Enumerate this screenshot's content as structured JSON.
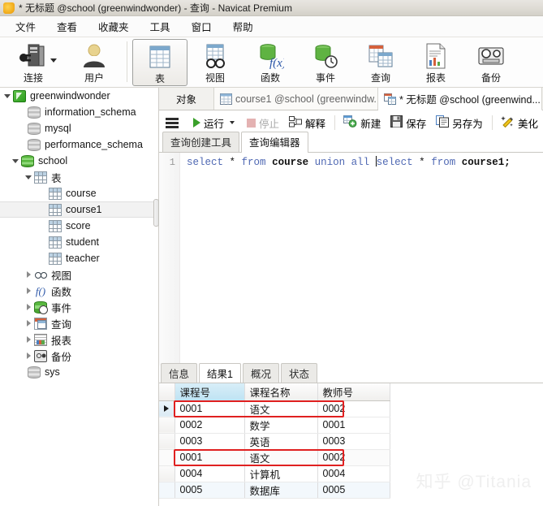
{
  "window": {
    "title": "* 无标题 @school (greenwindwonder) - 查询 - Navicat Premium",
    "app_icon": "navicat-icon"
  },
  "menubar": {
    "items": [
      {
        "label": "文件"
      },
      {
        "label": "查看"
      },
      {
        "label": "收藏夹"
      },
      {
        "label": "工具"
      },
      {
        "label": "窗口"
      },
      {
        "label": "帮助"
      }
    ]
  },
  "main_toolbar": {
    "groups": [
      {
        "items": [
          {
            "label": "连接",
            "icon": "connection-icon",
            "has_dropdown": true,
            "active": false
          },
          {
            "label": "用户",
            "icon": "user-icon",
            "has_dropdown": false,
            "active": false
          }
        ]
      },
      {
        "items": [
          {
            "label": "表",
            "icon": "table-icon",
            "has_dropdown": false,
            "active": true
          },
          {
            "label": "视图",
            "icon": "view-icon",
            "has_dropdown": false,
            "active": false
          },
          {
            "label": "函数",
            "icon": "function-icon",
            "has_dropdown": false,
            "active": false
          },
          {
            "label": "事件",
            "icon": "event-icon",
            "has_dropdown": false,
            "active": false
          },
          {
            "label": "查询",
            "icon": "query-icon",
            "has_dropdown": false,
            "active": false
          },
          {
            "label": "报表",
            "icon": "report-icon",
            "has_dropdown": false,
            "active": false
          },
          {
            "label": "备份",
            "icon": "backup-icon",
            "has_dropdown": false,
            "active": false
          }
        ]
      }
    ]
  },
  "sidebar": {
    "nodes": [
      {
        "label": "greenwindwonder",
        "icon": "connection-node-icon",
        "indent": 0,
        "arrow": "open",
        "selected": false
      },
      {
        "label": "information_schema",
        "icon": "database-icon",
        "indent": 1,
        "arrow": "none",
        "selected": false
      },
      {
        "label": "mysql",
        "icon": "database-icon",
        "indent": 1,
        "arrow": "none",
        "selected": false
      },
      {
        "label": "performance_schema",
        "icon": "database-icon",
        "indent": 1,
        "arrow": "none",
        "selected": false
      },
      {
        "label": "school",
        "icon": "database-green-icon",
        "indent": 1,
        "arrow": "open",
        "selected": false
      },
      {
        "label": "表",
        "icon": "table-folder-icon",
        "indent": 2,
        "arrow": "open",
        "selected": false
      },
      {
        "label": "course",
        "icon": "table-icon",
        "indent": 3,
        "arrow": "none",
        "selected": false
      },
      {
        "label": "course1",
        "icon": "table-icon",
        "indent": 3,
        "arrow": "none",
        "selected": true
      },
      {
        "label": "score",
        "icon": "table-icon",
        "indent": 3,
        "arrow": "none",
        "selected": false
      },
      {
        "label": "student",
        "icon": "table-icon",
        "indent": 3,
        "arrow": "none",
        "selected": false
      },
      {
        "label": "teacher",
        "icon": "table-icon",
        "indent": 3,
        "arrow": "none",
        "selected": false
      },
      {
        "label": "视图",
        "icon": "view-folder-icon",
        "indent": 2,
        "arrow": "closed",
        "selected": false
      },
      {
        "label": "函数",
        "icon": "function-folder-icon",
        "indent": 2,
        "arrow": "closed",
        "selected": false
      },
      {
        "label": "事件",
        "icon": "event-folder-icon",
        "indent": 2,
        "arrow": "closed",
        "selected": false
      },
      {
        "label": "查询",
        "icon": "query-folder-icon",
        "indent": 2,
        "arrow": "closed",
        "selected": false
      },
      {
        "label": "报表",
        "icon": "report-folder-icon",
        "indent": 2,
        "arrow": "closed",
        "selected": false
      },
      {
        "label": "备份",
        "icon": "backup-folder-icon",
        "indent": 2,
        "arrow": "closed",
        "selected": false
      },
      {
        "label": "sys",
        "icon": "database-icon",
        "indent": 1,
        "arrow": "none",
        "selected": false
      }
    ]
  },
  "tabstrip": {
    "object_tab": "对象",
    "documents": [
      {
        "label": "course1 @school (greenwindw...",
        "icon": "table-tab-icon",
        "active": false
      },
      {
        "label": "* 无标题 @school (greenwind...",
        "icon": "query-tab-icon",
        "active": true
      }
    ]
  },
  "query_toolbar": {
    "menu_icon": "hamburger-icon",
    "buttons": [
      {
        "label": "运行",
        "icon": "play-icon",
        "disabled": false,
        "dropdown": true
      },
      {
        "label": "停止",
        "icon": "stop-icon",
        "disabled": true,
        "dropdown": false
      },
      {
        "label": "解释",
        "icon": "explain-icon",
        "disabled": false,
        "dropdown": false
      },
      {
        "label": "新建",
        "icon": "new-icon",
        "disabled": false,
        "dropdown": false
      },
      {
        "label": "保存",
        "icon": "save-icon",
        "disabled": false,
        "dropdown": false
      },
      {
        "label": "另存为",
        "icon": "save-as-icon",
        "disabled": false,
        "dropdown": false
      },
      {
        "label": "美化",
        "icon": "beautify-icon",
        "disabled": false,
        "dropdown": false
      }
    ]
  },
  "editor_tabs": [
    {
      "label": "查询创建工具",
      "active": false
    },
    {
      "label": "查询编辑器",
      "active": true
    }
  ],
  "editor": {
    "line_number": "1",
    "sql_tokens": [
      {
        "text": "select",
        "type": "keyword"
      },
      {
        "text": " * ",
        "type": "plain"
      },
      {
        "text": "from",
        "type": "keyword"
      },
      {
        "text": " ",
        "type": "plain"
      },
      {
        "text": "course",
        "type": "identifier"
      },
      {
        "text": " ",
        "type": "plain"
      },
      {
        "text": "union",
        "type": "keyword"
      },
      {
        "text": " ",
        "type": "plain"
      },
      {
        "text": "all",
        "type": "keyword"
      },
      {
        "text": " ",
        "type": "plain"
      },
      {
        "text": "select",
        "type": "keyword"
      },
      {
        "text": " * ",
        "type": "plain"
      },
      {
        "text": "from",
        "type": "keyword"
      },
      {
        "text": " ",
        "type": "plain"
      },
      {
        "text": "course1;",
        "type": "identifier"
      }
    ],
    "sql_text": "select * from course union all select * from course1;",
    "caret_after_token_index": 9
  },
  "result_tabs": [
    {
      "label": "信息",
      "active": false
    },
    {
      "label": "结果1",
      "active": true
    },
    {
      "label": "概况",
      "active": false
    },
    {
      "label": "状态",
      "active": false
    }
  ],
  "result_grid": {
    "columns": [
      {
        "label": "课程号",
        "selected": true
      },
      {
        "label": "课程名称",
        "selected": false
      },
      {
        "label": "教师号",
        "selected": false
      }
    ],
    "rows": [
      {
        "cells": [
          "0001",
          "语文",
          "0002"
        ],
        "current": true,
        "highlighted": true
      },
      {
        "cells": [
          "0002",
          "数学",
          "0001"
        ],
        "current": false,
        "highlighted": false
      },
      {
        "cells": [
          "0003",
          "英语",
          "0003"
        ],
        "current": false,
        "highlighted": false
      },
      {
        "cells": [
          "0001",
          "语文",
          "0002"
        ],
        "current": false,
        "highlighted": true
      },
      {
        "cells": [
          "0004",
          "计算机",
          "0004"
        ],
        "current": false,
        "highlighted": false
      },
      {
        "cells": [
          "0005",
          "数据库",
          "0005"
        ],
        "current": false,
        "highlighted": false
      }
    ],
    "highlight_color": "#e02020"
  },
  "watermark": {
    "text": "知乎 @Titania",
    "color": "#efefef"
  }
}
